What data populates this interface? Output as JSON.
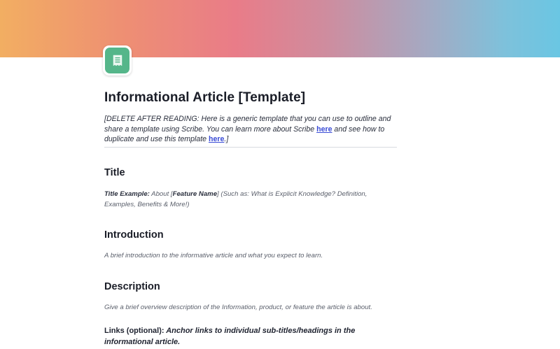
{
  "cover": {
    "colors": [
      "#f2ae62",
      "#e97c88",
      "#a5a9c2",
      "#6ac6e3"
    ]
  },
  "page_icon": {
    "name": "receipt-icon",
    "color": "#55b68a"
  },
  "page": {
    "title": "Informational Article [Template]"
  },
  "intro": {
    "lead": "[DELETE AFTER READING:",
    "text1": " Here is a generic template that you can use to outline and share a template using Scribe. You can learn more about Scribe ",
    "link1": "here",
    "text2": " and see how to duplicate and use this template ",
    "link2": "here",
    "text3": ".]"
  },
  "sections": {
    "title": {
      "heading": "Title",
      "example_label": "Title Example:",
      "example_mid": " About [",
      "example_bold": "Feature Name",
      "example_rest": "] (Such as: What is Explicit Knowledge? Definition, Examples, Benefits & More!)"
    },
    "introduction": {
      "heading": "Introduction",
      "text": " A brief introduction to the informative article and what you expect to learn."
    },
    "description": {
      "heading": "Description",
      "text": "Give a brief overview description of the Information, product, or feature the article is about."
    },
    "links": {
      "label": "Links (optional):",
      "text": " Anchor links to individual sub-titles/headings in the informational article."
    }
  }
}
